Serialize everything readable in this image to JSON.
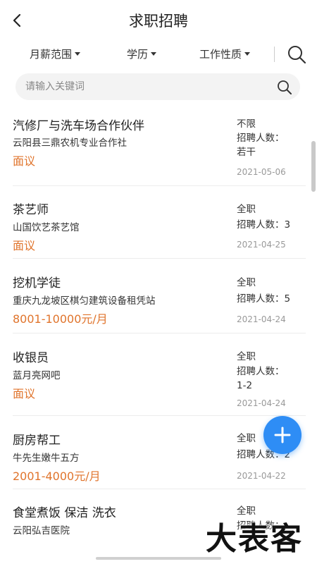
{
  "header": {
    "title": "求职招聘",
    "back_icon": "chevron-left-icon"
  },
  "filters": {
    "items": [
      {
        "label": "月薪范围"
      },
      {
        "label": "学历"
      },
      {
        "label": "工作性质"
      }
    ],
    "search_icon": "search-icon"
  },
  "search": {
    "placeholder": "请输入关键词",
    "icon": "search-icon"
  },
  "jobs": [
    {
      "title": "汽修厂与洗车场合作伙伴",
      "company": "云阳县三鼎农机专业合作社",
      "salary": "面议",
      "type": "不限",
      "hire_label": "招聘人数：",
      "hire_count": "若干",
      "date": "2021-05-06"
    },
    {
      "title": "茶艺师",
      "company": "山国饮艺茶艺馆",
      "salary": "面议",
      "type": "全职",
      "hire_label": "招聘人数：",
      "hire_count": "3",
      "date": "2021-04-25"
    },
    {
      "title": "挖机学徒",
      "company": "重庆九龙坡区棋匀建筑设备租凭站",
      "salary": "8001-10000元/月",
      "type": "全职",
      "hire_label": "招聘人数：",
      "hire_count": "5",
      "date": "2021-04-24"
    },
    {
      "title": "收银员",
      "company": "蓝月亮网吧",
      "salary": "面议",
      "type": "全职",
      "hire_label": "招聘人数：",
      "hire_count": "1-2",
      "date": "2021-04-24"
    },
    {
      "title": "厨房帮工",
      "company": "牛先生嫩牛五方",
      "salary": "2001-4000元/月",
      "type": "全职",
      "hire_label": "招聘人数：",
      "hire_count": "2",
      "date": "2021-04-22"
    },
    {
      "title": "食堂煮饭 保洁 洗衣",
      "company": "云阳弘吉医院",
      "salary": "",
      "type": "全职",
      "hire_label": "招聘人数：",
      "hire_count": "",
      "date": ""
    }
  ],
  "fab": {
    "icon": "plus-icon"
  },
  "watermark": {
    "text": "大表客"
  },
  "colors": {
    "accent": "#2e8df5",
    "salary": "#e0742c",
    "date": "#999999"
  }
}
